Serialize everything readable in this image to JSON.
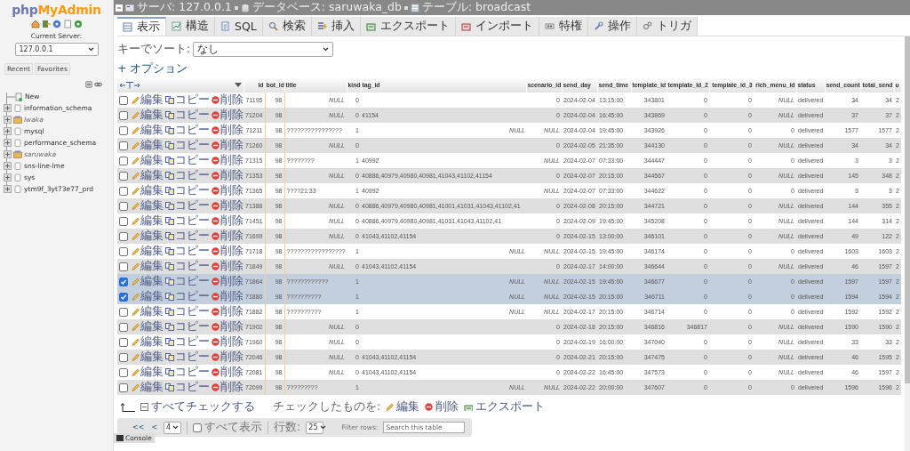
{
  "sidebar": {
    "logo": {
      "prefix": "php",
      "name": "MyAdmin"
    },
    "server_label": "Current Server:",
    "server": "127.0.0.1",
    "buttons": [
      "Recent",
      "Favorites"
    ],
    "tree": [
      {
        "label": "New",
        "kind": "new"
      },
      {
        "label": "information_schema",
        "kind": "db"
      },
      {
        "label": "lwaka",
        "kind": "group"
      },
      {
        "label": "mysql",
        "kind": "db"
      },
      {
        "label": "performance_schema",
        "kind": "db"
      },
      {
        "label": "saruwaka",
        "kind": "group"
      },
      {
        "label": "sns-line-lme",
        "kind": "db"
      },
      {
        "label": "sys",
        "kind": "db"
      },
      {
        "label": "ytm9f_3yt73e77_prd",
        "kind": "db"
      }
    ]
  },
  "breadcrumb": [
    {
      "label": "サーバ: 127.0.0.1",
      "kind": "server"
    },
    {
      "label": "データベース: saruwaka_db",
      "kind": "database"
    },
    {
      "label": "テーブル: broadcast",
      "kind": "table"
    }
  ],
  "tabs": [
    {
      "label": "表示",
      "kind": "browse",
      "selected": true
    },
    {
      "label": "構造",
      "kind": "structure",
      "selected": false
    },
    {
      "label": "SQL",
      "kind": "sql",
      "selected": false
    },
    {
      "label": "検索",
      "kind": "search",
      "selected": false
    },
    {
      "label": "挿入",
      "kind": "insert",
      "selected": false
    },
    {
      "label": "エクスポート",
      "kind": "export",
      "selected": false
    },
    {
      "label": "インポート",
      "kind": "import",
      "selected": false
    },
    {
      "label": "特権",
      "kind": "privileges",
      "selected": false
    },
    {
      "label": "操作",
      "kind": "operations",
      "selected": false
    },
    {
      "label": "トリガ",
      "kind": "triggers",
      "selected": false
    }
  ],
  "sort": {
    "label": "キーでソート:",
    "value": "なし"
  },
  "options_link": "+ オプション",
  "table": {
    "columns": [
      "id",
      "bot_id",
      "title",
      "kind",
      "tag_id",
      "scenario_id",
      "send_day",
      "send_time",
      "template_id",
      "template_id_2",
      "template_id_3",
      "rich_menu_id",
      "status",
      "send_count",
      "total_send",
      "u"
    ],
    "rows": [
      {
        "selected": false,
        "actions": [
          "編集",
          "コピー",
          "削除"
        ],
        "cells": [
          "71195",
          "98",
          {
            "text": "NULL",
            "kind": "null"
          },
          "0",
          null,
          "0",
          "2024-02-04",
          "13:15:00",
          "343801",
          "0",
          "0",
          {
            "text": "NULL",
            "kind": "null"
          },
          "delivered",
          "34",
          "34",
          "2"
        ]
      },
      {
        "selected": false,
        "actions": [
          "編集",
          "コピー",
          "削除"
        ],
        "cells": [
          "71204",
          "98",
          {
            "text": "NULL",
            "kind": "null"
          },
          "0",
          "41154",
          "0",
          "2024-02-04",
          "16:45:00",
          "343869",
          "0",
          "0",
          {
            "text": "NULL",
            "kind": "null"
          },
          "delivered",
          "37",
          "37",
          "2"
        ]
      },
      {
        "selected": false,
        "actions": [
          "編集",
          "コピー",
          "削除"
        ],
        "cells": [
          "71211",
          "98",
          "????????????????",
          "1",
          {
            "text": "NULL",
            "kind": "null"
          },
          {
            "text": "NULL",
            "kind": "null"
          },
          "2024-02-04",
          "19:45:00",
          "343926",
          "0",
          "0",
          "0",
          "delivered",
          "1577",
          "1577",
          "2"
        ]
      },
      {
        "selected": false,
        "actions": [
          "編集",
          "コピー",
          "削除"
        ],
        "cells": [
          "71260",
          "98",
          {
            "text": "NULL",
            "kind": "null"
          },
          "0",
          null,
          "0",
          "2024-02-05",
          "21:35:00",
          "344130",
          "0",
          "0",
          {
            "text": "NULL",
            "kind": "null"
          },
          "delivered",
          "34",
          "34",
          "2"
        ]
      },
      {
        "selected": false,
        "actions": [
          "編集",
          "コピー",
          "削除"
        ],
        "cells": [
          "71315",
          "98",
          "????????",
          "1",
          "40992",
          {
            "text": "NULL",
            "kind": "null"
          },
          "2024-02-07",
          "07:33:00",
          "344447",
          "0",
          "0",
          "0",
          "delivered",
          "3",
          "3",
          "2"
        ]
      },
      {
        "selected": false,
        "actions": [
          "編集",
          "コピー",
          "削除"
        ],
        "cells": [
          "71353",
          "98",
          {
            "text": "NULL",
            "kind": "null"
          },
          "0",
          "40886,40979,40980,40981,41043,41102,41154",
          "0",
          "2024-02-07",
          "20:15:00",
          "344567",
          "0",
          "0",
          {
            "text": "NULL",
            "kind": "null"
          },
          "delivered",
          "145",
          "348",
          "2"
        ]
      },
      {
        "selected": false,
        "actions": [
          "編集",
          "コピー",
          "削除"
        ],
        "cells": [
          "71365",
          "98",
          "????21:33",
          "1",
          "40992",
          {
            "text": "NULL",
            "kind": "null"
          },
          "2024-02-07",
          "07:33:00",
          "344622",
          "0",
          "0",
          "0",
          "delivered",
          "3",
          "3",
          "2"
        ]
      },
      {
        "selected": false,
        "actions": [
          "編集",
          "コピー",
          "削除"
        ],
        "cells": [
          "71388",
          "98",
          {
            "text": "NULL",
            "kind": "null"
          },
          "0",
          "40886,40979,40980,40981,41001,41031,41043,41102,41",
          "0",
          "2024-02-08",
          "20:15:00",
          "344721",
          "0",
          "0",
          {
            "text": "NULL",
            "kind": "null"
          },
          "delivered",
          "144",
          "355",
          "2"
        ]
      },
      {
        "selected": false,
        "actions": [
          "編集",
          "コピー",
          "削除"
        ],
        "cells": [
          "71451",
          "98",
          {
            "text": "NULL",
            "kind": "null"
          },
          "0",
          "40886,40979,40980,40981,41031,41043,41102,41",
          "0",
          "2024-02-09",
          "19:45:00",
          "345208",
          "0",
          "0",
          {
            "text": "NULL",
            "kind": "null"
          },
          "delivered",
          "144",
          "314",
          "2"
        ]
      },
      {
        "selected": false,
        "actions": [
          "編集",
          "コピー",
          "削除"
        ],
        "cells": [
          "71699",
          "98",
          {
            "text": "NULL",
            "kind": "null"
          },
          "0",
          "41043,41102,41154",
          "0",
          "2024-02-15",
          "13:00:00",
          "346101",
          "0",
          "0",
          {
            "text": "NULL",
            "kind": "null"
          },
          "delivered",
          "49",
          "122",
          "2"
        ]
      },
      {
        "selected": false,
        "actions": [
          "編集",
          "コピー",
          "削除"
        ],
        "cells": [
          "71718",
          "98",
          "?????????????????",
          "1",
          {
            "text": "NULL",
            "kind": "null"
          },
          {
            "text": "NULL",
            "kind": "null"
          },
          "2024-02-15",
          "19:45:00",
          "346174",
          "0",
          "0",
          "0",
          "delivered",
          "1603",
          "1603",
          "2"
        ]
      },
      {
        "selected": false,
        "actions": [
          "編集",
          "コピー",
          "削除"
        ],
        "cells": [
          "71849",
          "98",
          {
            "text": "NULL",
            "kind": "null"
          },
          "0",
          "41043,41102,41154",
          "0",
          "2024-02-17",
          "14:00:00",
          "346644",
          "0",
          "0",
          {
            "text": "NULL",
            "kind": "null"
          },
          "delivered",
          "46",
          "1597",
          "2"
        ]
      },
      {
        "selected": true,
        "actions": [
          "編集",
          "コピー",
          "削除"
        ],
        "cells": [
          "71864",
          "98",
          "????????????",
          "1",
          {
            "text": "NULL",
            "kind": "null"
          },
          {
            "text": "NULL",
            "kind": "null"
          },
          "2024-02-15",
          "19:45:00",
          "346677",
          "0",
          "0",
          "0",
          "delivered",
          "1597",
          "1597",
          "2"
        ]
      },
      {
        "selected": true,
        "actions": [
          "編集",
          "コピー",
          "削除"
        ],
        "cells": [
          "71880",
          "98",
          "??????????",
          "1",
          {
            "text": "NULL",
            "kind": "null"
          },
          {
            "text": "NULL",
            "kind": "null"
          },
          "2024-02-15",
          "20:15:00",
          "346711",
          "0",
          "0",
          "0",
          "delivered",
          "1594",
          "1594",
          "2"
        ]
      },
      {
        "selected": false,
        "actions": [
          "編集",
          "コピー",
          "削除"
        ],
        "cells": [
          "71882",
          "98",
          "??????????",
          "1",
          {
            "text": "NULL",
            "kind": "null"
          },
          {
            "text": "NULL",
            "kind": "null"
          },
          "2024-02-17",
          "20:15:00",
          "346714",
          "0",
          "0",
          "0",
          "delivered",
          "1592",
          "1592",
          "2"
        ]
      },
      {
        "selected": false,
        "actions": [
          "編集",
          "コピー",
          "削除"
        ],
        "cells": [
          "71902",
          "98",
          {
            "text": "NULL",
            "kind": "null"
          },
          "0",
          null,
          "0",
          "2024-02-18",
          "20:15:00",
          "346816",
          "346817",
          "0",
          {
            "text": "NULL",
            "kind": "null"
          },
          "delivered",
          "1590",
          "1590",
          "2"
        ]
      },
      {
        "selected": false,
        "actions": [
          "編集",
          "コピー",
          "削除"
        ],
        "cells": [
          "71960",
          "98",
          {
            "text": "NULL",
            "kind": "null"
          },
          "0",
          null,
          "0",
          "2024-02-19",
          "16:00:00",
          "347040",
          "0",
          "0",
          {
            "text": "NULL",
            "kind": "null"
          },
          "delivered",
          "33",
          "33",
          "2"
        ]
      },
      {
        "selected": false,
        "actions": [
          "編集",
          "コピー",
          "削除"
        ],
        "cells": [
          "72046",
          "98",
          {
            "text": "NULL",
            "kind": "null"
          },
          "0",
          "41043,41102,41154",
          "0",
          "2024-02-21",
          "20:15:00",
          "347475",
          "0",
          "0",
          {
            "text": "NULL",
            "kind": "null"
          },
          "delivered",
          "46",
          "1595",
          "2"
        ]
      },
      {
        "selected": false,
        "actions": [
          "編集",
          "コピー",
          "削除"
        ],
        "cells": [
          "72081",
          "98",
          {
            "text": "NULL",
            "kind": "null"
          },
          "0",
          "41043,41102,41154",
          "0",
          "2024-02-22",
          "16:45:00",
          "347573",
          "0",
          "0",
          {
            "text": "NULL",
            "kind": "null"
          },
          "delivered",
          "46",
          "1597",
          "2"
        ]
      },
      {
        "selected": false,
        "actions": [
          "編集",
          "コピー",
          "削除"
        ],
        "cells": [
          "72099",
          "98",
          "?????????",
          "1",
          {
            "text": "NULL",
            "kind": "null"
          },
          {
            "text": "NULL",
            "kind": "null"
          },
          "2024-02-22",
          "20:00:00",
          "347607",
          "0",
          "0",
          "0",
          "delivered",
          "1596",
          "1596",
          "2"
        ]
      }
    ]
  },
  "bulk": {
    "check_all": "すべてチェックする",
    "with_selected": "チェックしたものを:",
    "actions": [
      {
        "label": "編集",
        "kind": "edit"
      },
      {
        "label": "削除",
        "kind": "delete"
      },
      {
        "label": "エクスポート",
        "kind": "export"
      }
    ]
  },
  "pager": {
    "first": "<<",
    "prev": "<",
    "page": "4",
    "show_all": {
      "label": "すべて表示",
      "checked": false
    },
    "rows_label": "行数:",
    "rows": "25",
    "filter_label": "Filter rows:",
    "filter_placeholder": "Search this table"
  },
  "console": "Console"
}
